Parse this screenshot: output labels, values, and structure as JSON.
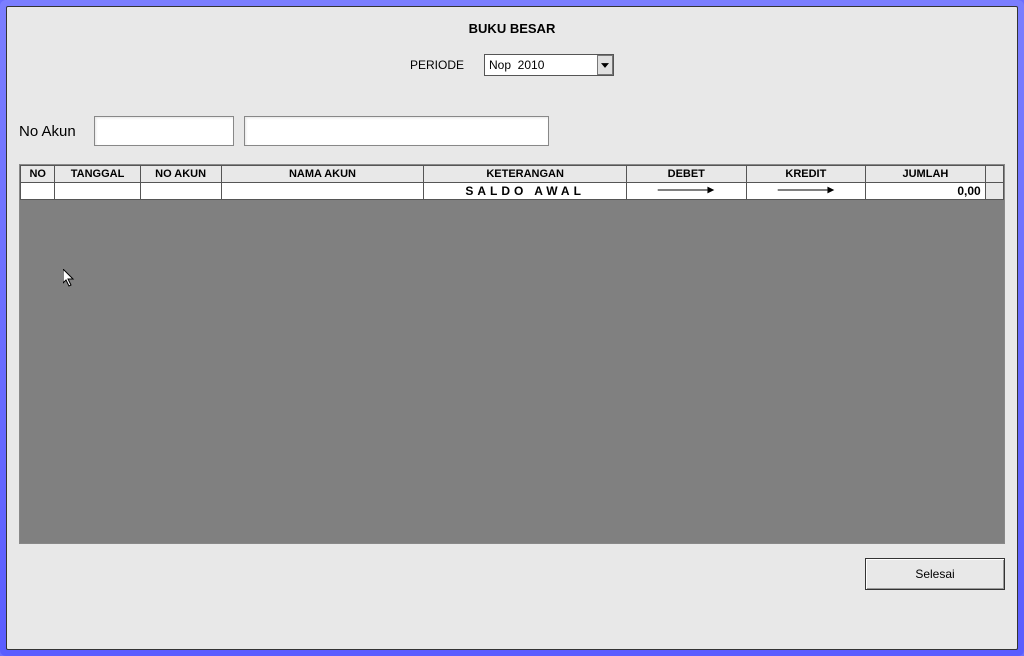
{
  "title": "BUKU BESAR",
  "periode": {
    "label": "PERIODE",
    "value": "Nop  2010"
  },
  "akun": {
    "label": "No Akun",
    "code": "",
    "name": ""
  },
  "table": {
    "headers": [
      "NO",
      "TANGGAL",
      "NO AKUN",
      "NAMA AKUN",
      "KETERANGAN",
      "DEBET",
      "KREDIT",
      "JUMLAH"
    ],
    "rows": [
      {
        "no": "",
        "tanggal": "",
        "no_akun": "",
        "nama_akun": "",
        "keterangan": "SALDO AWAL",
        "debet": "→",
        "kredit": "→",
        "jumlah": "0,00"
      }
    ]
  },
  "buttons": {
    "close": "Selesai"
  }
}
